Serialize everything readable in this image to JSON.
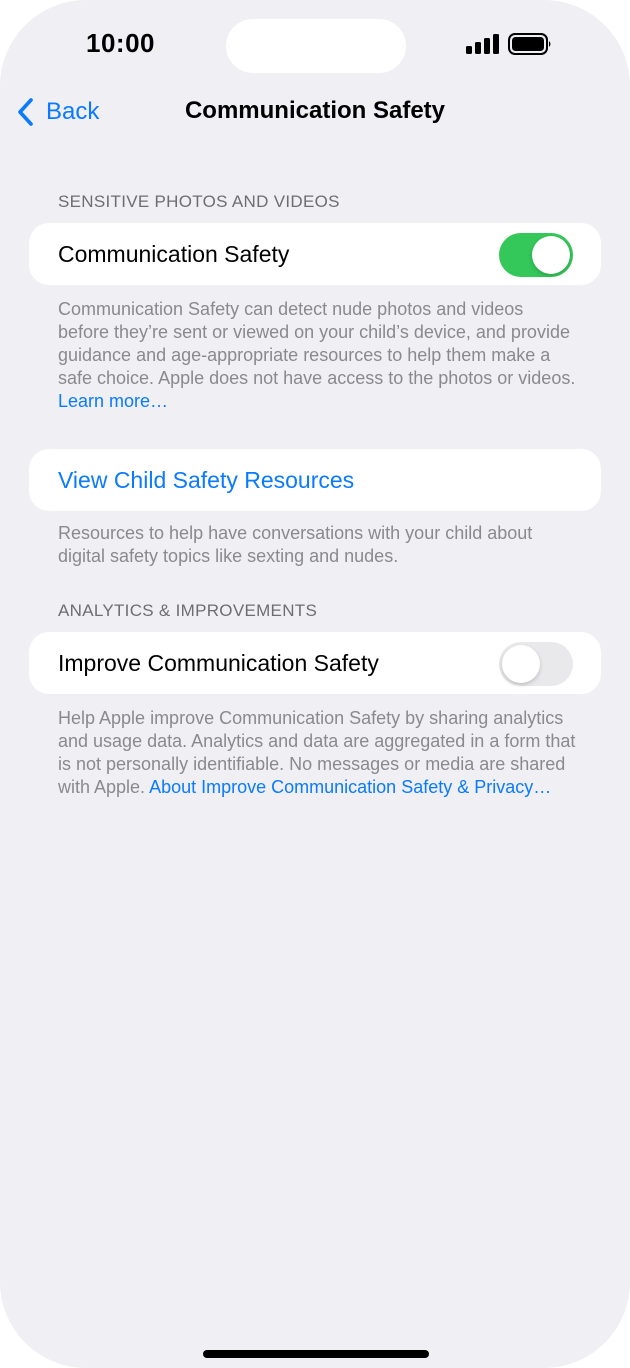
{
  "status_bar": {
    "time": "10:00",
    "icons": [
      "cellular-signal-icon",
      "battery-icon"
    ]
  },
  "nav": {
    "back_label": "Back",
    "title": "Communication Safety"
  },
  "sections": {
    "sensitive": {
      "header": "SENSITIVE PHOTOS AND VIDEOS",
      "toggle_label": "Communication Safety",
      "toggle_on": true,
      "footer_text": "Communication Safety can detect nude photos and videos before they’re sent or viewed on your child’s device, and provide guidance and age-appropriate resources to help them make a safe choice. Apple does not have access to the photos or videos.",
      "footer_link": "Learn more…"
    },
    "resources": {
      "link_label": "View Child Safety Resources",
      "footer_text": "Resources to help have conversations with your child about digital safety topics like sexting and nudes."
    },
    "analytics": {
      "header": "ANALYTICS & IMPROVEMENTS",
      "toggle_label": "Improve Communication Safety",
      "toggle_on": false,
      "footer_text": "Help Apple improve Communication Safety by sharing analytics and usage data. Analytics and data are aggregated in a form that is not personally identifiable. No messages or media are shared with Apple.",
      "footer_link": "About Improve Communication Safety & Privacy…"
    }
  },
  "colors": {
    "accent": "#0a7aff",
    "toggle_on": "#34c759",
    "toggle_off": "#e9e9eb",
    "background": "#efeff4",
    "secondary_text": "#8a8a8e"
  }
}
